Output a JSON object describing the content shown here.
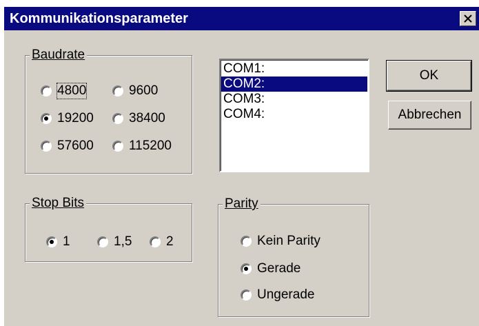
{
  "dialog": {
    "title": "Kommunikationsparameter",
    "close_icon": "close-icon"
  },
  "baudrate": {
    "label": "Baudrate",
    "options": [
      "4800",
      "9600",
      "19200",
      "38400",
      "57600",
      "115200"
    ],
    "selected": "19200"
  },
  "ports": {
    "items": [
      "COM1:",
      "COM2:",
      "COM3:",
      "COM4:"
    ],
    "selected": "COM2:"
  },
  "buttons": {
    "ok_label": "OK",
    "cancel_label": "Abbrechen"
  },
  "stopbits": {
    "label": "Stop Bits",
    "options": [
      "1",
      "1,5",
      "2"
    ],
    "selected": "1"
  },
  "parity": {
    "label": "Parity",
    "options": [
      "Kein Parity",
      "Gerade",
      "Ungerade"
    ],
    "selected": "Gerade"
  },
  "colors": {
    "titlebar": "#0a0a80",
    "face": "#d4d0c8",
    "selection": "#0a0a80"
  }
}
